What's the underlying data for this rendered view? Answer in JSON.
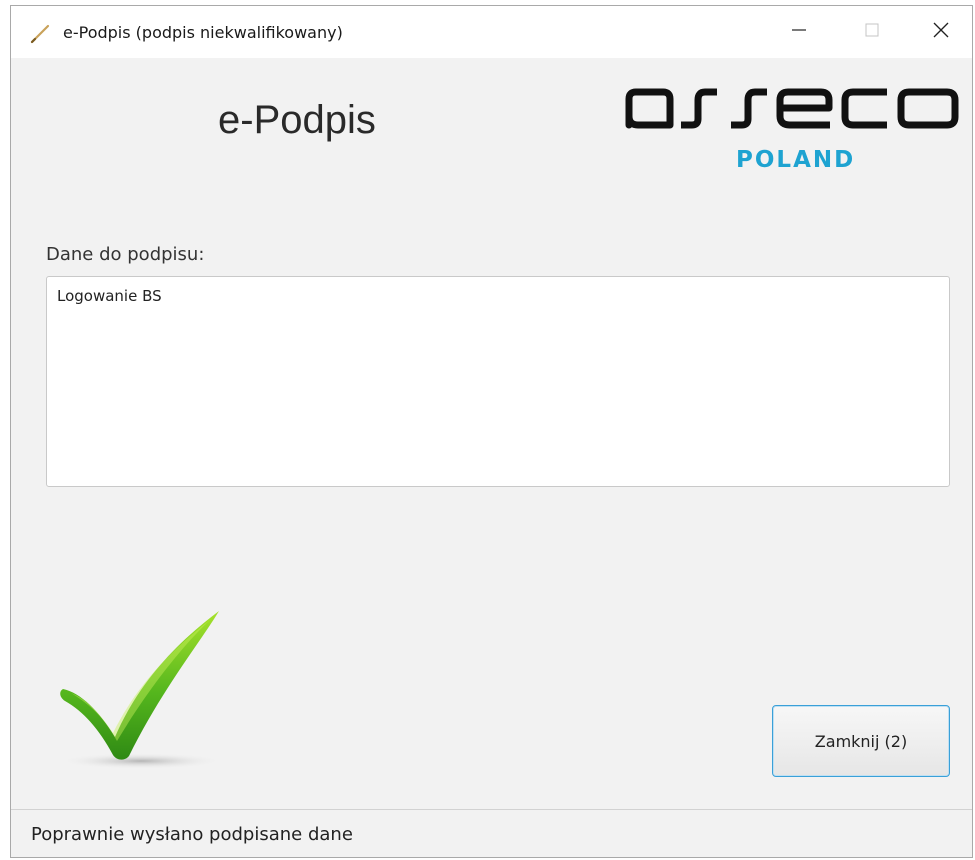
{
  "window": {
    "title": "e-Podpis (podpis niekwalifikowany)",
    "title_icon": "pen-icon",
    "controls": {
      "minimize": "minimize-icon",
      "maximize": "maximize-icon",
      "close": "close-icon"
    }
  },
  "header": {
    "app_title": "e-Podpis",
    "logo_text": "asseco",
    "logo_subtext": "POLAND",
    "logo_color": "#1ea3d1"
  },
  "form": {
    "label": "Dane do podpisu:",
    "content": "Logowanie BS"
  },
  "status_icon": "checkmark-icon",
  "actions": {
    "close_label": "Zamknij (2)"
  },
  "status_bar": {
    "text": "Poprawnie wysłano podpisane dane"
  }
}
